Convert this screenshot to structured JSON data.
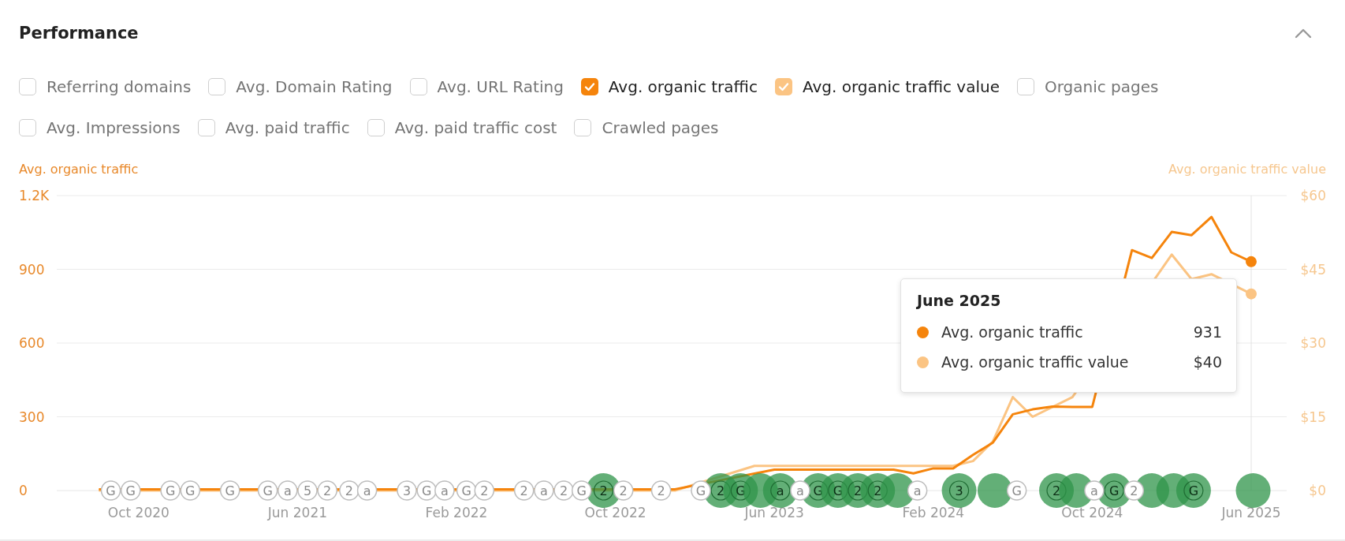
{
  "panel": {
    "title": "Performance",
    "expanded": true
  },
  "metric_rows": [
    [
      {
        "label": "Referring domains",
        "checked": false
      },
      {
        "label": "Avg. Domain Rating",
        "checked": false
      },
      {
        "label": "Avg. URL Rating",
        "checked": false
      },
      {
        "label": "Avg. organic traffic",
        "checked": true,
        "color": "#f5840c"
      },
      {
        "label": "Avg. organic traffic value",
        "checked": true,
        "color": "#fbc483"
      },
      {
        "label": "Organic pages",
        "checked": false
      }
    ],
    [
      {
        "label": "Avg. Impressions",
        "checked": false
      },
      {
        "label": "Avg. paid traffic",
        "checked": false
      },
      {
        "label": "Avg. paid traffic cost",
        "checked": false
      },
      {
        "label": "Crawled pages",
        "checked": false
      }
    ]
  ],
  "chart_data": {
    "type": "line",
    "grid": true,
    "ylim": [
      0,
      1200
    ],
    "y2lim": [
      0,
      60
    ],
    "yticks": [
      {
        "value": 0,
        "label": "0"
      },
      {
        "value": 300,
        "label": "300"
      },
      {
        "value": 600,
        "label": "600"
      },
      {
        "value": 900,
        "label": "900"
      },
      {
        "value": 1200,
        "label": "1.2K"
      }
    ],
    "y2ticks": [
      {
        "value": 0,
        "label": "$0"
      },
      {
        "value": 15,
        "label": "$15"
      },
      {
        "value": 30,
        "label": "$30"
      },
      {
        "value": 45,
        "label": "$45"
      },
      {
        "value": 60,
        "label": "$60"
      }
    ],
    "categories": [
      null,
      null,
      "Oct 2020",
      null,
      null,
      null,
      null,
      null,
      null,
      null,
      "Jun 2021",
      null,
      null,
      null,
      null,
      null,
      null,
      null,
      "Feb 2022",
      null,
      null,
      null,
      null,
      null,
      null,
      null,
      "Oct 2022",
      null,
      null,
      null,
      null,
      null,
      null,
      null,
      "Jun 2023",
      null,
      null,
      null,
      null,
      null,
      null,
      null,
      "Feb 2024",
      null,
      null,
      null,
      null,
      null,
      null,
      null,
      "Oct 2024",
      null,
      null,
      null,
      null,
      null,
      null,
      null,
      "Jun 2025"
    ],
    "series": [
      {
        "name": "Avg. organic traffic",
        "color": "#f5840c",
        "values": [
          5,
          null,
          5,
          5,
          null,
          5,
          5,
          5,
          5,
          5,
          5,
          5,
          5,
          null,
          5,
          5,
          5,
          null,
          5,
          null,
          5,
          5,
          null,
          null,
          null,
          5,
          null,
          5,
          null,
          5,
          null,
          null,
          null,
          null,
          85,
          85,
          85,
          85,
          85,
          85,
          85,
          70,
          90,
          90,
          145,
          195,
          310,
          330,
          342,
          340,
          340,
          null,
          978,
          946,
          1052,
          1039,
          1113,
          969,
          931
        ]
      },
      {
        "name": "Avg. organic traffic value",
        "color": "#fbc483",
        "axis": "y2",
        "values": [
          0,
          null,
          0,
          0,
          0,
          0,
          0,
          0,
          0,
          0,
          0,
          0,
          0,
          null,
          0,
          0,
          0,
          null,
          0,
          null,
          0,
          0,
          0,
          0,
          null,
          0,
          null,
          0,
          null,
          0,
          null,
          null,
          null,
          5,
          5,
          5,
          5,
          5,
          5,
          5,
          5,
          5,
          5,
          5,
          6,
          10,
          19,
          15,
          null,
          19,
          null,
          null,
          null,
          null,
          48,
          43,
          44,
          null,
          40
        ]
      }
    ]
  },
  "timeline_markers": [
    {
      "text": "G",
      "kind": "marker"
    },
    {
      "text": "G",
      "kind": "marker"
    },
    {
      "text": "G",
      "kind": "marker"
    },
    {
      "text": "G",
      "kind": "marker"
    },
    {
      "text": "G",
      "kind": "marker"
    },
    {
      "text": "G",
      "kind": "marker"
    },
    {
      "text": "a",
      "kind": "marker"
    },
    {
      "text": "5",
      "kind": "marker"
    },
    {
      "text": "2",
      "kind": "marker"
    },
    {
      "text": "2",
      "kind": "marker"
    },
    {
      "text": "a",
      "kind": "marker"
    },
    {
      "text": "3",
      "kind": "marker"
    },
    {
      "text": "G",
      "kind": "marker"
    },
    {
      "text": "a",
      "kind": "marker"
    },
    {
      "text": "G",
      "kind": "marker"
    },
    {
      "text": "2",
      "kind": "marker"
    },
    {
      "text": "2",
      "kind": "marker"
    },
    {
      "text": "a",
      "kind": "marker"
    },
    {
      "text": "2",
      "kind": "marker"
    },
    {
      "text": "G",
      "kind": "marker"
    },
    {
      "text": "2",
      "kind": "event"
    },
    {
      "text": "2",
      "kind": "marker"
    },
    {
      "text": "2",
      "kind": "marker"
    },
    {
      "text": "G",
      "kind": "marker"
    },
    {
      "text": "2",
      "kind": "event"
    },
    {
      "text": "G",
      "kind": "event"
    },
    {
      "kind": "event"
    },
    {
      "text": "a",
      "kind": "event"
    },
    {
      "text": "a",
      "kind": "marker"
    },
    {
      "text": "G",
      "kind": "event"
    },
    {
      "text": "G",
      "kind": "event"
    },
    {
      "text": "2",
      "kind": "event"
    },
    {
      "text": "2",
      "kind": "event"
    },
    {
      "kind": "event"
    },
    {
      "text": "a",
      "kind": "marker"
    },
    {
      "text": "3",
      "kind": "event"
    },
    {
      "kind": "event"
    },
    {
      "text": "G",
      "kind": "marker"
    },
    {
      "text": "2",
      "kind": "event"
    },
    {
      "kind": "event"
    },
    {
      "text": "a",
      "kind": "marker"
    },
    {
      "text": "G",
      "kind": "event"
    },
    {
      "text": "2",
      "kind": "marker"
    },
    {
      "kind": "event"
    },
    {
      "kind": "event"
    },
    {
      "text": "G",
      "kind": "event"
    },
    {
      "kind": "event"
    }
  ],
  "tooltip": {
    "title": "June 2025",
    "rows": [
      {
        "label": "Avg. organic traffic",
        "value": "931",
        "color": "#f5840c"
      },
      {
        "label": "Avg. organic traffic value",
        "value": "$40",
        "color": "#fbc483"
      }
    ]
  }
}
